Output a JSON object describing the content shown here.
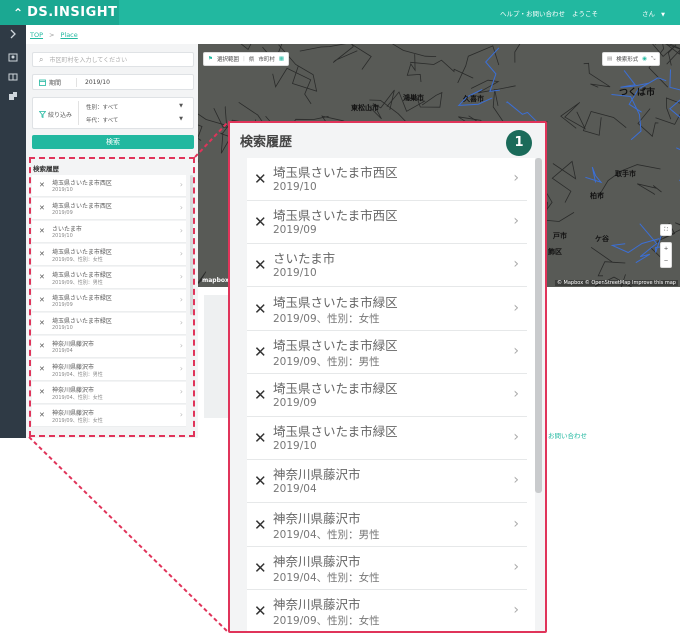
{
  "header": {
    "logo_mark": "⌃",
    "logo_text": "DS.INSIGHT",
    "help_link": "ヘルプ・お問い合わせ",
    "welcome": "ようこそ",
    "user": "さん"
  },
  "breadcrumb": {
    "top": "TOP",
    "sep": ">",
    "current": "Place"
  },
  "side": {
    "search_placeholder": "市区町村を入力してください",
    "period_label": "期間",
    "period_value": "2019/10",
    "filter_label": "絞り込み",
    "gender_label": "性別：すべて",
    "age_label": "年代：すべて",
    "search_button": "検索",
    "history_title": "検索履歴"
  },
  "history_small": [
    {
      "title": "埼玉県さいたま市西区",
      "sub": "2019/10"
    },
    {
      "title": "埼玉県さいたま市西区",
      "sub": "2019/09"
    },
    {
      "title": "さいたま市",
      "sub": "2019/10"
    },
    {
      "title": "埼玉県さいたま市緑区",
      "sub": "2019/09、性別：女性"
    },
    {
      "title": "埼玉県さいたま市緑区",
      "sub": "2019/09、性別：男性"
    },
    {
      "title": "埼玉県さいたま市緑区",
      "sub": "2019/09"
    },
    {
      "title": "埼玉県さいたま市緑区",
      "sub": "2019/10"
    },
    {
      "title": "神奈川県藤沢市",
      "sub": "2019/04"
    },
    {
      "title": "神奈川県藤沢市",
      "sub": "2019/04、性別：男性"
    },
    {
      "title": "神奈川県藤沢市",
      "sub": "2019/04、性別：女性"
    },
    {
      "title": "神奈川県藤沢市",
      "sub": "2019/09、性別：女性"
    }
  ],
  "map": {
    "btn_selection": "選択範囲",
    "btn_pref": "県",
    "btn_city": "市町村",
    "btn_search_format": "検索形式",
    "cities": [
      "東松山市",
      "鴻巣市",
      "久喜市",
      "つくば市",
      "取手市",
      "柏市",
      "戸市",
      "ケ谷",
      "飾区"
    ],
    "mapbox_logo": "mapbox",
    "attribution": "© Mapbox © OpenStreetMap  Improve this map"
  },
  "footer_link": "お問い合わせ",
  "callout": {
    "badge": "1",
    "title": "検索履歴",
    "items": [
      {
        "title": "埼玉県さいたま市西区",
        "sub": "2019/10"
      },
      {
        "title": "埼玉県さいたま市西区",
        "sub": "2019/09"
      },
      {
        "title": "さいたま市",
        "sub": "2019/10"
      },
      {
        "title": "埼玉県さいたま市緑区",
        "sub": "2019/09、性別：女性"
      },
      {
        "title": "埼玉県さいたま市緑区",
        "sub": "2019/09、性別：男性"
      },
      {
        "title": "埼玉県さいたま市緑区",
        "sub": "2019/09"
      },
      {
        "title": "埼玉県さいたま市緑区",
        "sub": "2019/10"
      },
      {
        "title": "神奈川県藤沢市",
        "sub": "2019/04"
      },
      {
        "title": "神奈川県藤沢市",
        "sub": "2019/04、性別：男性"
      },
      {
        "title": "神奈川県藤沢市",
        "sub": "2019/04、性別：女性"
      },
      {
        "title": "神奈川県藤沢市",
        "sub": "2019/09、性別：女性"
      }
    ]
  },
  "glyphs": {
    "close": "✕",
    "chevron": "›",
    "caret": "▼",
    "search": "⌕"
  },
  "colors": {
    "brand": "#22b8a0",
    "highlight": "#e0345a",
    "badge": "#1b6b5a",
    "nav": "#2f3a45"
  }
}
